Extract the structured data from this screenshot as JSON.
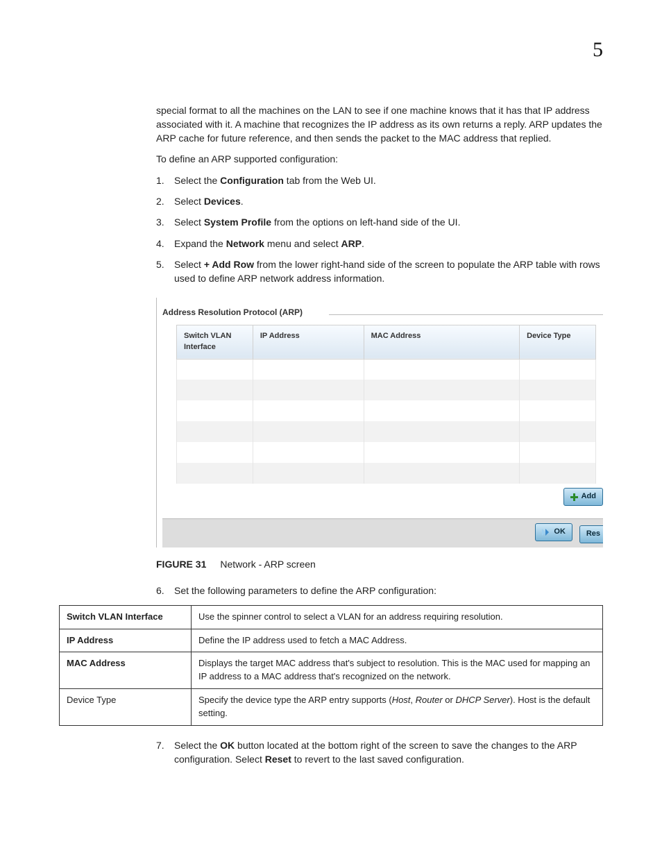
{
  "pageNumber": "5",
  "intro": {
    "p1": "special format to all the machines on the LAN to see if one machine knows that it has that IP address associated with it. A machine that recognizes the IP address as its own returns a reply. ARP updates the ARP cache for future reference, and then sends the packet to the MAC address that replied.",
    "p2": "To define an ARP supported configuration:"
  },
  "steps1": [
    {
      "n": "1.",
      "pre": "Select the ",
      "b1": "Configuration",
      "post": " tab from the Web UI."
    },
    {
      "n": "2.",
      "pre": "Select ",
      "b1": "Devices",
      "post": "."
    },
    {
      "n": "3.",
      "pre": "Select ",
      "b1": "System Profile",
      "post": " from the options on left-hand side of the UI."
    },
    {
      "n": "4.",
      "pre": "Expand the ",
      "b1": "Network",
      "mid": " menu and select ",
      "b2": "ARP",
      "post": "."
    },
    {
      "n": "5.",
      "pre": "Select ",
      "b1": "+ Add Row",
      "post": " from the lower right-hand side of the screen to populate the ARP table with rows used to define ARP network address information."
    }
  ],
  "figure": {
    "legend": "Address Resolution Protocol (ARP)",
    "headers": [
      "Switch VLAN Interface",
      "IP Address",
      "MAC Address",
      "Device Type"
    ],
    "buttons": {
      "add": "Add",
      "ok": "OK",
      "reset": "Res"
    },
    "captionLabel": "FIGURE 31",
    "captionText": "Network - ARP screen"
  },
  "step6": {
    "n": "6.",
    "text": "Set the following parameters to define the ARP configuration:"
  },
  "params": [
    {
      "k": "Switch VLAN Interface",
      "v": "Use the spinner control to select a VLAN for an address requiring resolution."
    },
    {
      "k": "IP Address",
      "v": "Define the IP address used to fetch a MAC Address."
    },
    {
      "k": "MAC Address",
      "v": "Displays the target MAC address that's subject to resolution. This is the MAC used for mapping an IP address to a MAC address that's recognized on the network."
    },
    {
      "k": "Device Type",
      "vPre": "Specify the device type the ARP entry supports (",
      "i1": "Host",
      "s1": ", ",
      "i2": "Router",
      "s2": " or ",
      "i3": "DHCP Server",
      "vPost": "). Host is the default setting."
    }
  ],
  "step7": {
    "n": "7.",
    "pre": "Select the ",
    "b1": "OK",
    "mid": " button located at the bottom right of the screen to save the changes to the ARP configuration. Select ",
    "b2": "Reset",
    "post": " to revert to the last saved configuration."
  }
}
